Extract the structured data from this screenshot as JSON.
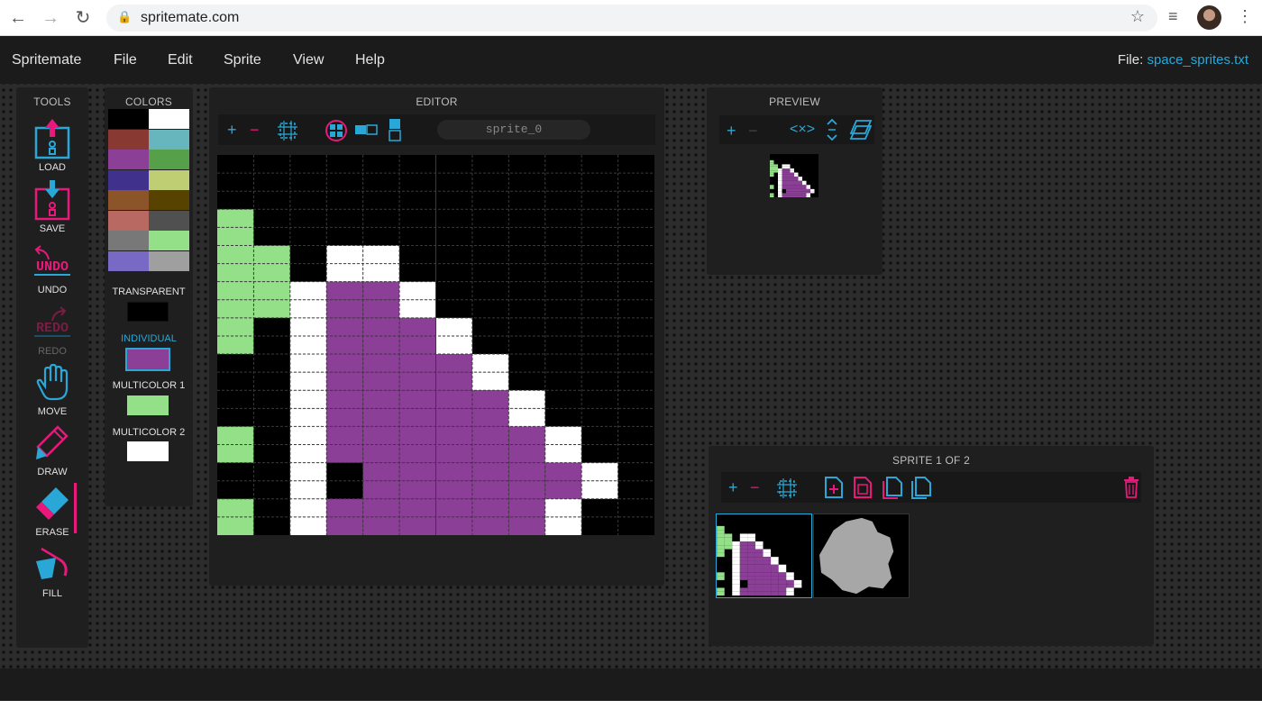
{
  "browser": {
    "url": "spritemate.com",
    "back_icon": "arrow-left-icon",
    "forward_icon": "arrow-right-icon",
    "reload_icon": "reload-icon",
    "lock_icon": "lock-icon",
    "star_icon": "star-icon",
    "media_icon": "media-control-icon",
    "menu_icon": "kebab-menu-icon"
  },
  "menu": {
    "app_name": "Spritemate",
    "items": [
      "File",
      "Edit",
      "Sprite",
      "View",
      "Help"
    ],
    "file_prefix": "File:",
    "file_name": "space_sprites.txt"
  },
  "tools": {
    "title": "TOOLS",
    "items": [
      {
        "label": "LOAD",
        "icon": "load-icon"
      },
      {
        "label": "SAVE",
        "icon": "save-icon"
      },
      {
        "label": "UNDO",
        "icon": "undo-icon",
        "icon_text": "UNDO"
      },
      {
        "label": "REDO",
        "icon": "redo-icon",
        "icon_text": "REDO"
      },
      {
        "label": "MOVE",
        "icon": "hand-icon"
      },
      {
        "label": "DRAW",
        "icon": "pencil-icon"
      },
      {
        "label": "ERASE",
        "icon": "eraser-icon"
      },
      {
        "label": "FILL",
        "icon": "paint-bucket-icon"
      }
    ],
    "active": "ERASE"
  },
  "colors": {
    "title": "COLORS",
    "palette": [
      "#000000",
      "#ffffff",
      "#883932",
      "#67b6bd",
      "#8b3f96",
      "#55a049",
      "#40318d",
      "#bfce72",
      "#8b5429",
      "#574200",
      "#b86962",
      "#505050",
      "#787878",
      "#94e089",
      "#7869c4",
      "#9f9f9f"
    ],
    "transparent_label": "TRANSPARENT",
    "individual_label": "INDIVIDUAL",
    "multicolor1_label": "MULTICOLOR 1",
    "multicolor2_label": "MULTICOLOR 2",
    "transparent_color": "#000000",
    "individual_color": "#8b3f96",
    "multicolor1_color": "#94e089",
    "multicolor2_color": "#ffffff"
  },
  "editor": {
    "title": "EDITOR",
    "sprite_name": "sprite_0",
    "grid_cols": 12,
    "grid_rows": 21,
    "pixels": [
      "............",
      "............",
      "............",
      "G...........",
      "G...........",
      "GG.WW.......",
      "GG.WW.......",
      "GGWPPW......",
      "GGWPPW......",
      "G.WPPPW.....",
      "G.WPPPW.....",
      "..WPPPPW....",
      "..WPPPPW....",
      "..WPPPPPW...",
      "..WPPPPPW...",
      "G.WPPPPPPW..",
      "G.WPPPPPPW..",
      "..W.PPPPPPW.",
      "..W.PPPPPPW.",
      "G.WPPPPPPW..",
      "G.WPPPPPPW.."
    ]
  },
  "preview": {
    "title": "PREVIEW"
  },
  "sprite_list": {
    "title": "SPRITE 1 OF 2",
    "thumbnails": [
      "sprite_0",
      "sprite_1"
    ]
  }
}
